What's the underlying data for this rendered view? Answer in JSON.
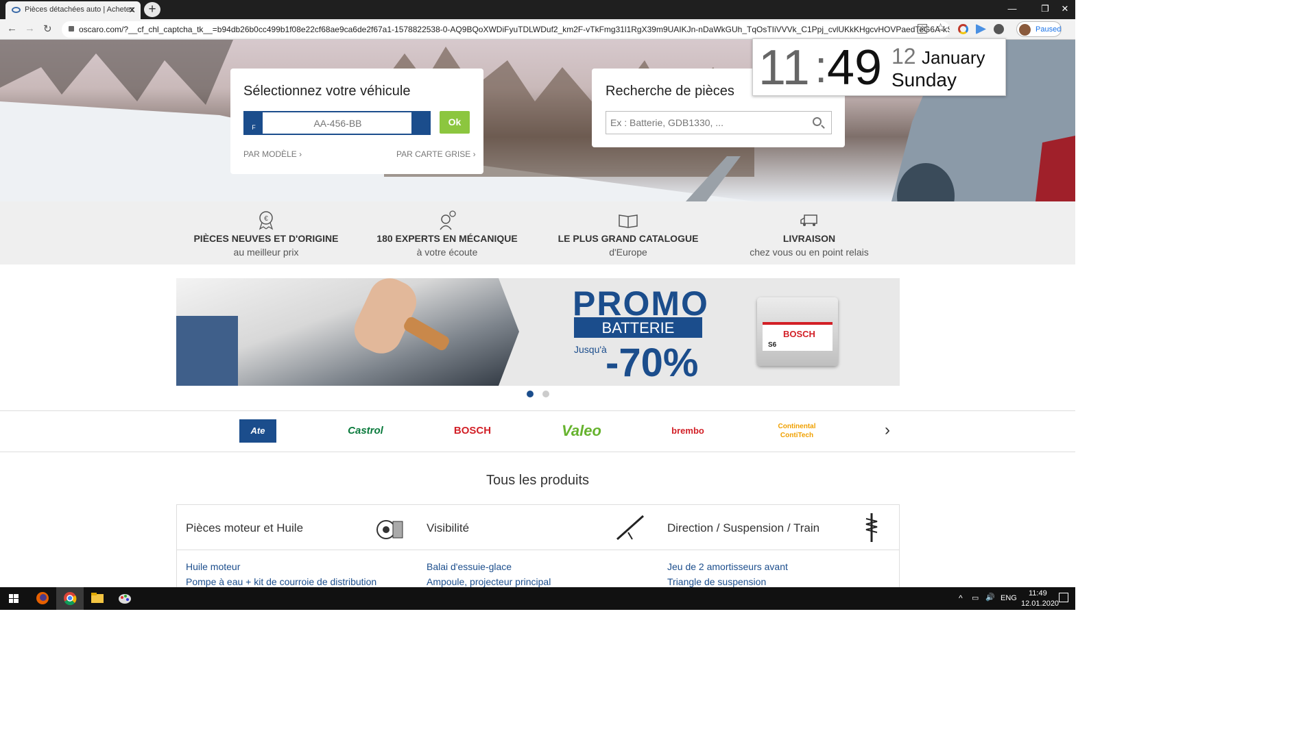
{
  "browser": {
    "tab_title": "Pièces détachées auto | Achetez",
    "url": "oscaro.com/?__cf_chl_captcha_tk__=b94db26b0cc499b1f08e22cf68ae9ca6de2f67a1-1578822538-0-AQ9BQoXWDiFyuTDLWDuf2_km2F-vTkFmg31l1RgX39m9UAIKJn-nDaWkGUh_TqOsTIiVVVk_C1Ppj_cvlUKkKHgcvHOVPaedTeG6A-kSfo9N0...",
    "profile_status": "Paused"
  },
  "clock_widget": {
    "hour": "11",
    "colon": ":",
    "minute": "49",
    "day": "12",
    "month": "January",
    "weekday": "Sunday"
  },
  "vehicle_card": {
    "title": "Sélectionnez votre véhicule",
    "plate_country": "F",
    "plate_placeholder": "AA-456-BB",
    "ok_label": "Ok",
    "by_model": "PAR MODÈLE",
    "by_registration": "PAR CARTE GRISE"
  },
  "search_card": {
    "title": "Recherche de pièces",
    "placeholder": "Ex : Batterie, GDB1330, ..."
  },
  "features": [
    {
      "icon": "medal-euro-icon",
      "title": "PIÈCES NEUVES ET D'ORIGINE",
      "subtitle": "au meilleur prix"
    },
    {
      "icon": "expert-headset-icon",
      "title": "180 EXPERTS EN MÉCANIQUE",
      "subtitle": "à votre écoute"
    },
    {
      "icon": "open-book-icon",
      "title": "LE PLUS GRAND CATALOGUE",
      "subtitle": "d'Europe"
    },
    {
      "icon": "delivery-truck-icon",
      "title": "LIVRAISON",
      "subtitle": "chez vous ou en point relais"
    }
  ],
  "promo_banner": {
    "headline": "PROMO",
    "product": "BATTERIE",
    "prefix": "Jusqu'à",
    "discount": "-70%",
    "battery_brand": "BOSCH",
    "battery_model": "S6",
    "slide_count": 2,
    "active_slide": 1
  },
  "brands": [
    {
      "name": "Ate",
      "color": "#1b4d8c"
    },
    {
      "name": "Castrol",
      "color": "#0a7a3c"
    },
    {
      "name": "BOSCH",
      "color": "#d21f26"
    },
    {
      "name": "Valeo",
      "color": "#66b32e"
    },
    {
      "name": "brembo",
      "color": "#d21f26"
    },
    {
      "name": "Continental ContiTech",
      "color": "#f0a000"
    }
  ],
  "products_heading": "Tous les produits",
  "categories": [
    {
      "title": "Pièces moteur et Huile",
      "icon": "engine-oil-icon",
      "items": [
        "Huile moteur",
        "Pompe à eau + kit de courroie de distribution"
      ]
    },
    {
      "title": "Visibilité",
      "icon": "wiper-blade-icon",
      "items": [
        "Balai d'essuie-glace",
        "Ampoule, projecteur principal"
      ]
    },
    {
      "title": "Direction / Suspension / Train",
      "icon": "shock-absorber-icon",
      "items": [
        "Jeu de 2 amortisseurs avant",
        "Triangle de suspension"
      ]
    }
  ],
  "taskbar": {
    "language": "ENG",
    "time": "11:49",
    "date": "12.01.2020"
  },
  "colors": {
    "brand_blue": "#1b4d8c",
    "ok_green": "#8cc63f",
    "feature_bg": "#efefef"
  }
}
